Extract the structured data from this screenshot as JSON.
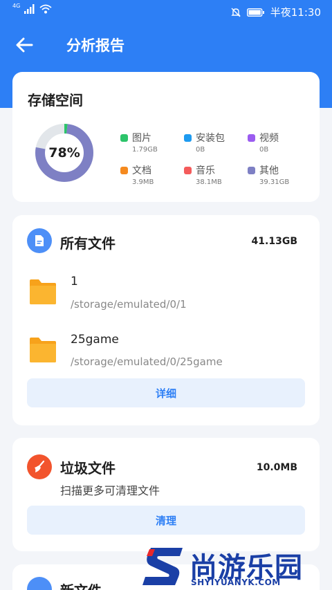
{
  "status_bar": {
    "network": "4G",
    "time": "半夜11:30"
  },
  "app_bar": {
    "title": "分析报告"
  },
  "storage": {
    "title": "存储空间",
    "percent_label": "78%",
    "used_fraction": 0.78,
    "legend": [
      {
        "name": "图片",
        "size": "1.79GB",
        "color": "#2cc46a"
      },
      {
        "name": "安装包",
        "size": "0B",
        "color": "#1e9bf0"
      },
      {
        "name": "视频",
        "size": "0B",
        "color": "#9b5cf0"
      },
      {
        "name": "文档",
        "size": "3.9MB",
        "color": "#f58a1f"
      },
      {
        "name": "音乐",
        "size": "38.1MB",
        "color": "#f45b5b"
      },
      {
        "name": "其他",
        "size": "39.31GB",
        "color": "#7e80c4"
      }
    ],
    "track_color": "#e2e6ea"
  },
  "all_files": {
    "title": "所有文件",
    "size": "41.13GB",
    "items": [
      {
        "name": "1",
        "path": "/storage/emulated/0/1"
      },
      {
        "name": "25game",
        "path": "/storage/emulated/0/25game"
      }
    ],
    "button_label": "详细"
  },
  "junk": {
    "title": "垃圾文件",
    "size": "10.0MB",
    "subtitle": "扫描更多可清理文件",
    "button_label": "清理"
  },
  "new_files": {
    "title": "新文件"
  },
  "watermark": {
    "text": "尚游乐园",
    "url": "SHYIYUANYK.COM"
  }
}
